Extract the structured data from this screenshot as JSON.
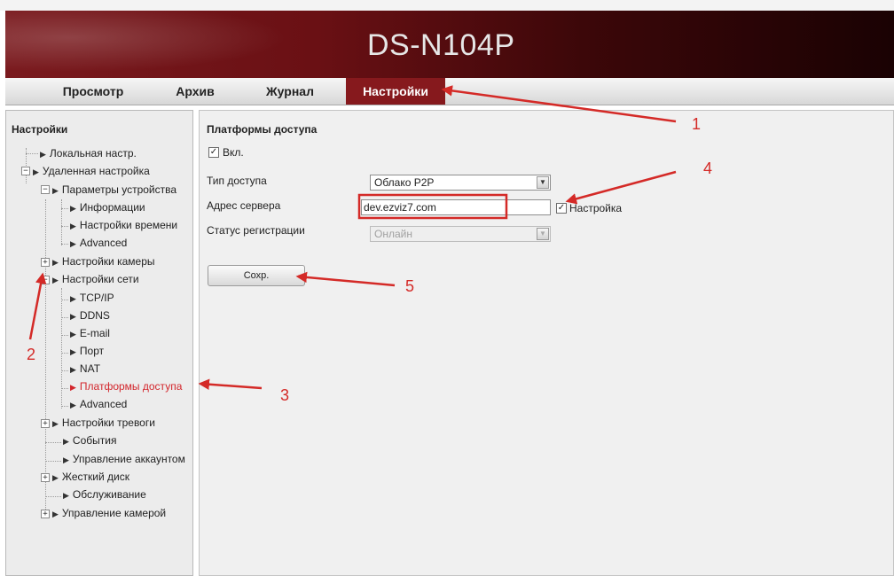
{
  "header": {
    "model": "DS-N104P"
  },
  "nav": {
    "tabs": [
      {
        "label": "Просмотр"
      },
      {
        "label": "Архив"
      },
      {
        "label": "Журнал"
      },
      {
        "label": "Настройки",
        "active": true
      }
    ]
  },
  "sidebar": {
    "title": "Настройки",
    "items": [
      {
        "label": "Локальная настр."
      },
      {
        "label": "Удаленная настройка"
      },
      {
        "label": "Параметры устройства"
      },
      {
        "label": "Информации"
      },
      {
        "label": "Настройки времени"
      },
      {
        "label": "Advanced"
      },
      {
        "label": "Настройки камеры"
      },
      {
        "label": "Настройки сети"
      },
      {
        "label": "TCP/IP"
      },
      {
        "label": "DDNS"
      },
      {
        "label": "E-mail"
      },
      {
        "label": "Порт"
      },
      {
        "label": "NAT"
      },
      {
        "label": "Платформы доступа",
        "active": true
      },
      {
        "label": "Advanced"
      },
      {
        "label": "Настройки тревоги"
      },
      {
        "label": "События"
      },
      {
        "label": "Управление аккаунтом"
      },
      {
        "label": "Жесткий диск"
      },
      {
        "label": "Обслуживание"
      },
      {
        "label": "Управление камерой"
      }
    ]
  },
  "main": {
    "title": "Платформы доступа",
    "enable": {
      "label": "Вкл.",
      "checked": true
    },
    "access_type": {
      "label": "Тип доступа",
      "value": "Облако P2P"
    },
    "server_address": {
      "label": "Адрес сервера",
      "value": "dev.ezviz7.com"
    },
    "custom": {
      "label": "Настройка",
      "checked": true
    },
    "reg_status": {
      "label": "Статус регистрации",
      "value": "Онлайн"
    },
    "save_label": "Сохр."
  },
  "annotations": {
    "numbers": [
      "1",
      "2",
      "3",
      "4",
      "5"
    ],
    "color": "#d42a27"
  },
  "colors": {
    "accent": "#86191d",
    "highlight": "#d3262c"
  }
}
